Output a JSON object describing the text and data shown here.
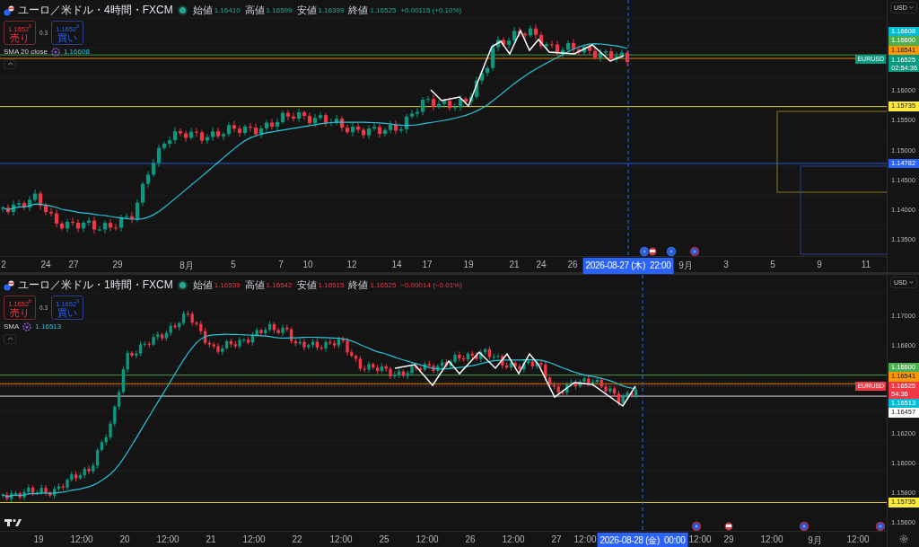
{
  "panes": [
    {
      "symbol": "ユーロ／米ドル・4時間・FXCM",
      "ohlc": [
        {
          "label": "始値",
          "value": "1.16410"
        },
        {
          "label": "高値",
          "value": "1.16599"
        },
        {
          "label": "安値",
          "value": "1.16399"
        },
        {
          "label": "終値",
          "value": "1.16525"
        }
      ],
      "change": "+0.00115 (+0.10%)",
      "sell": {
        "price": "1.1652$^{6}$",
        "label": "売り"
      },
      "spread": "0.3",
      "buy": {
        "price": "1.1652$^{9}$",
        "label": "買い"
      },
      "indicator": {
        "name": "SMA 20 close",
        "value": "1.16608"
      },
      "currency": "USD",
      "price_ticks": [
        "1.16000",
        "1.15500",
        "1.15000",
        "1.14500",
        "1.14000",
        "1.13500"
      ],
      "price_lines": [
        {
          "kind": "sma",
          "price": "1.16608",
          "color": "#00bcd4"
        },
        {
          "kind": "level",
          "price": "1.16600",
          "color": "#4caf50"
        },
        {
          "kind": "level",
          "price": "1.16541",
          "color": "#ff9800"
        },
        {
          "kind": "last",
          "price": "1.16525",
          "color": "#089981",
          "tag": "EURUSD",
          "countdown": "02:54:36"
        },
        {
          "kind": "level",
          "price": "1.15735",
          "color": "#ffeb3b"
        },
        {
          "kind": "level",
          "price": "1.14782",
          "color": "#2962ff"
        }
      ],
      "time_ticks": [
        "2",
        "24",
        "27",
        "29",
        "8月",
        "5",
        "7",
        "10",
        "12",
        "14",
        "17",
        "19",
        "21",
        "24",
        "26",
        "9月",
        "3",
        "5",
        "9",
        "11"
      ],
      "cursor": {
        "date": "2026-08-27 (木)",
        "time": "22:00"
      }
    },
    {
      "symbol": "ユーロ／米ドル・1時間・FXCM",
      "ohlc": [
        {
          "label": "始値",
          "value": "1.16539"
        },
        {
          "label": "高値",
          "value": "1.16542"
        },
        {
          "label": "安値",
          "value": "1.16515"
        },
        {
          "label": "終値",
          "value": "1.16525"
        }
      ],
      "change": "−0.00014 (−0.01%)",
      "sell": {
        "price": "1.1652$^{6}$",
        "label": "売り"
      },
      "spread": "0.3",
      "buy": {
        "price": "1.1652$^{9}$",
        "label": "買い"
      },
      "indicator": {
        "name": "SMA",
        "value": "1.16513"
      },
      "currency": "USD",
      "price_ticks": [
        "1.17000",
        "1.16800",
        "1.16200",
        "1.16000",
        "1.15800",
        "1.15600"
      ],
      "price_lines": [
        {
          "kind": "level",
          "price": "1.16600",
          "color": "#4caf50"
        },
        {
          "kind": "level",
          "price": "1.16541",
          "color": "#ff9800"
        },
        {
          "kind": "last",
          "price": "1.16525",
          "color": "#f23645",
          "tag": "EURUSD",
          "countdown": "54:36"
        },
        {
          "kind": "sma",
          "price": "1.16513",
          "color": "#00bcd4"
        },
        {
          "kind": "level",
          "price": "1.16457",
          "color": "#ffffff"
        },
        {
          "kind": "level",
          "price": "1.15735",
          "color": "#ffeb3b"
        }
      ],
      "time_ticks": [
        "19",
        "12:00",
        "20",
        "12:00",
        "21",
        "12:00",
        "22",
        "12:00",
        "25",
        "12:00",
        "26",
        "12:00",
        "27",
        "12:00",
        "12:00",
        "29",
        "12:00",
        "9月",
        "12:00"
      ],
      "cursor": {
        "date": "2026-08-28 (金)",
        "time": "00:00"
      }
    }
  ]
}
